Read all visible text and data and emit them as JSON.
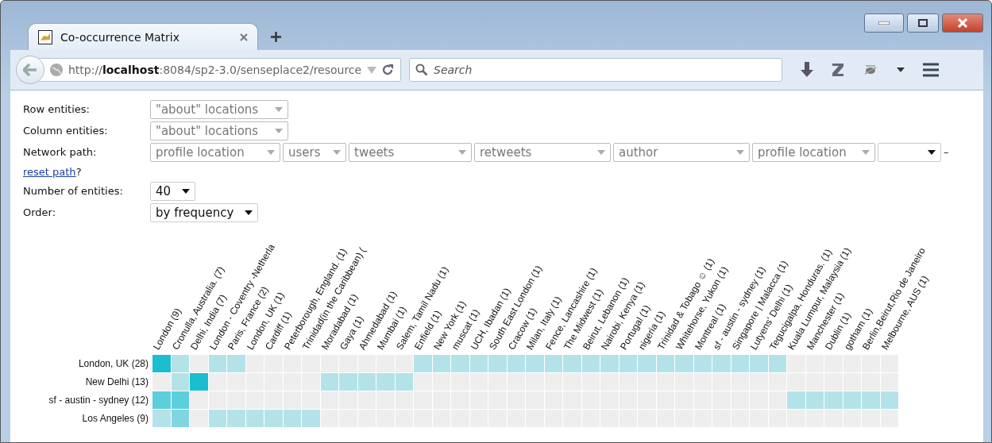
{
  "browser": {
    "tab": {
      "title": "Co-occurrence Matrix",
      "selected": true
    },
    "url_prefix": "http://",
    "url_host": "localhost",
    "url_rest": ":8084/sp2-3.0/senseplace2/resource",
    "search": {
      "placeholder": "Search"
    }
  },
  "form": {
    "fields": [
      {
        "label": "Row entities:",
        "selects": [
          {
            "value": "\"about\" locations",
            "disabled": true
          }
        ]
      },
      {
        "label": "Column entities:",
        "selects": [
          {
            "value": "\"about\" locations",
            "disabled": true
          }
        ]
      },
      {
        "label": "Network path:",
        "selects": [
          {
            "value": "profile location",
            "disabled": true
          },
          {
            "value": "users",
            "disabled": true
          },
          {
            "value": "tweets",
            "disabled": true
          },
          {
            "value": "retweets",
            "disabled": true
          },
          {
            "value": "author",
            "disabled": true
          },
          {
            "value": "profile location",
            "disabled": true
          },
          {
            "disabled": false
          }
        ],
        "suffix": "–"
      }
    ],
    "reset_link": "reset path",
    "reset_suffix": "?",
    "options": [
      {
        "label": "Number of entities:",
        "value": "40"
      },
      {
        "label": "Order:",
        "value": "by frequency"
      }
    ]
  },
  "matrix": {
    "columns": [
      "London (9)",
      "Cronulla, Australia. (7)",
      "Delhi, India (7)",
      "London - Coventry -Netherla",
      "Paris, France (2)",
      "London, UK (1)",
      "Cardiff (1)",
      "Peterborough, England. (1)",
      "Trinidad(in the Caribbean) (",
      "Moradabad (1)",
      "Gaya (1)",
      "Ahmedabad (1)",
      "Mumbai (1)",
      "Salem, Tamil Nadu (1)",
      "Enfield (1)",
      "New York (1)",
      "muscat (1)",
      "UCH, Ibadan (1)",
      "South East London (1)",
      "Cracow (1)",
      "Milan, Italy (1)",
      "Fence, Lancashire (1)",
      "The Midwest (1)",
      "Beirut, Lebanon (1)",
      "Nairobi, Kenya (1)",
      "Portugal (1)",
      "nigeria (1)",
      "Trinidad & Tobago ☺ (1)",
      "Whitehorse, Yukon (1)",
      "Montreal (1)",
      "sf - austin - sydney (1)",
      "Singapore | Malacca (1)",
      "Lutyens' Delhi (1)",
      "Tegucigalpa, Honduras. (1)",
      "Kuala Lumpur, Malaysia (1)",
      "Manchester (1)",
      "Dublin (1)",
      "gotham (1)",
      "Berlin,Beirut,Rio de Janeiro",
      "Melbourne, AUS (1)"
    ],
    "rows": [
      {
        "label": "London, UK (28)",
        "cells": [
          {
            "color": "#1bbdd0"
          },
          {
            "color": "#b3e3e8"
          },
          {
            "color": "#eeeeee"
          },
          {
            "color": "#b3e3e8"
          },
          {
            "color": "#b3e3e8"
          },
          {
            "color": "#eeeeee"
          },
          {
            "color": "#eeeeee"
          },
          {
            "color": "#eeeeee"
          },
          {
            "color": "#eeeeee"
          },
          {
            "color": "#eeeeee"
          },
          {
            "color": "#eeeeee"
          },
          {
            "color": "#eeeeee"
          },
          {
            "color": "#eeeeee"
          },
          {
            "color": "#eeeeee"
          },
          {
            "color": "#b3e3e8"
          },
          {
            "color": "#b3e3e8"
          },
          {
            "color": "#b3e3e8"
          },
          {
            "color": "#b3e3e8"
          },
          {
            "color": "#b3e3e8"
          },
          {
            "color": "#b3e3e8"
          },
          {
            "color": "#b3e3e8"
          },
          {
            "color": "#b3e3e8"
          },
          {
            "color": "#b3e3e8"
          },
          {
            "color": "#b3e3e8"
          },
          {
            "color": "#b3e3e8"
          },
          {
            "color": "#b3e3e8"
          },
          {
            "color": "#b3e3e8"
          },
          {
            "color": "#b3e3e8"
          },
          {
            "color": "#b3e3e8"
          },
          {
            "color": "#b3e3e8"
          },
          {
            "color": "#b3e3e8"
          },
          {
            "color": "#b3e3e8"
          },
          {
            "color": "#b3e3e8"
          },
          {
            "color": "#b3e3e8"
          },
          {
            "color": "#eeeeee"
          },
          {
            "color": "#eeeeee"
          },
          {
            "color": "#eeeeee"
          },
          {
            "color": "#eeeeee"
          },
          {
            "color": "#eeeeee"
          },
          {
            "color": "#eeeeee"
          }
        ]
      },
      {
        "label": "New Delhi (13)",
        "cells": [
          {
            "color": "#eeeeee"
          },
          {
            "color": "#b3e3e8"
          },
          {
            "color": "#1bbdd0"
          },
          {
            "color": "#eeeeee"
          },
          {
            "color": "#eeeeee"
          },
          {
            "color": "#eeeeee"
          },
          {
            "color": "#eeeeee"
          },
          {
            "color": "#eeeeee"
          },
          {
            "color": "#eeeeee"
          },
          {
            "color": "#b3e3e8"
          },
          {
            "color": "#b3e3e8"
          },
          {
            "color": "#b3e3e8"
          },
          {
            "color": "#b3e3e8"
          },
          {
            "color": "#b3e3e8"
          },
          {
            "color": "#eeeeee"
          },
          {
            "color": "#eeeeee"
          },
          {
            "color": "#eeeeee"
          },
          {
            "color": "#eeeeee"
          },
          {
            "color": "#eeeeee"
          },
          {
            "color": "#eeeeee"
          },
          {
            "color": "#eeeeee"
          },
          {
            "color": "#eeeeee"
          },
          {
            "color": "#eeeeee"
          },
          {
            "color": "#eeeeee"
          },
          {
            "color": "#eeeeee"
          },
          {
            "color": "#eeeeee"
          },
          {
            "color": "#eeeeee"
          },
          {
            "color": "#eeeeee"
          },
          {
            "color": "#eeeeee"
          },
          {
            "color": "#eeeeee"
          },
          {
            "color": "#eeeeee"
          },
          {
            "color": "#eeeeee"
          },
          {
            "color": "#eeeeee"
          },
          {
            "color": "#eeeeee"
          },
          {
            "color": "#eeeeee"
          },
          {
            "color": "#eeeeee"
          },
          {
            "color": "#eeeeee"
          },
          {
            "color": "#eeeeee"
          },
          {
            "color": "#eeeeee"
          },
          {
            "color": "#eeeeee"
          }
        ]
      },
      {
        "label": "sf - austin - sydney (12)",
        "cells": [
          {
            "color": "#5ccfdc"
          },
          {
            "color": "#5ccfdc"
          },
          {
            "color": "#eeeeee"
          },
          {
            "color": "#eeeeee"
          },
          {
            "color": "#eeeeee"
          },
          {
            "color": "#eeeeee"
          },
          {
            "color": "#eeeeee"
          },
          {
            "color": "#eeeeee"
          },
          {
            "color": "#eeeeee"
          },
          {
            "color": "#eeeeee"
          },
          {
            "color": "#eeeeee"
          },
          {
            "color": "#eeeeee"
          },
          {
            "color": "#eeeeee"
          },
          {
            "color": "#eeeeee"
          },
          {
            "color": "#eeeeee"
          },
          {
            "color": "#eeeeee"
          },
          {
            "color": "#eeeeee"
          },
          {
            "color": "#eeeeee"
          },
          {
            "color": "#eeeeee"
          },
          {
            "color": "#eeeeee"
          },
          {
            "color": "#eeeeee"
          },
          {
            "color": "#eeeeee"
          },
          {
            "color": "#eeeeee"
          },
          {
            "color": "#eeeeee"
          },
          {
            "color": "#eeeeee"
          },
          {
            "color": "#eeeeee"
          },
          {
            "color": "#eeeeee"
          },
          {
            "color": "#eeeeee"
          },
          {
            "color": "#eeeeee"
          },
          {
            "color": "#eeeeee"
          },
          {
            "color": "#eeeeee"
          },
          {
            "color": "#eeeeee"
          },
          {
            "color": "#eeeeee"
          },
          {
            "color": "#eeeeee"
          },
          {
            "color": "#b3e3e8"
          },
          {
            "color": "#b3e3e8"
          },
          {
            "color": "#b3e3e8"
          },
          {
            "color": "#b3e3e8"
          },
          {
            "color": "#b3e3e8"
          },
          {
            "color": "#b3e3e8"
          }
        ]
      },
      {
        "label": "Los Angeles (9)",
        "cells": [
          {
            "color": "#b3e3e8"
          },
          {
            "color": "#7fd6e0"
          },
          {
            "color": "#eeeeee"
          },
          {
            "color": "#b3e3e8"
          },
          {
            "color": "#b3e3e8"
          },
          {
            "color": "#b3e3e8"
          },
          {
            "color": "#b3e3e8"
          },
          {
            "color": "#b3e3e8"
          },
          {
            "color": "#b3e3e8"
          },
          {
            "color": "#eeeeee"
          },
          {
            "color": "#eeeeee"
          },
          {
            "color": "#eeeeee"
          },
          {
            "color": "#eeeeee"
          },
          {
            "color": "#eeeeee"
          },
          {
            "color": "#eeeeee"
          },
          {
            "color": "#eeeeee"
          },
          {
            "color": "#eeeeee"
          },
          {
            "color": "#eeeeee"
          },
          {
            "color": "#eeeeee"
          },
          {
            "color": "#eeeeee"
          },
          {
            "color": "#eeeeee"
          },
          {
            "color": "#eeeeee"
          },
          {
            "color": "#eeeeee"
          },
          {
            "color": "#eeeeee"
          },
          {
            "color": "#eeeeee"
          },
          {
            "color": "#eeeeee"
          },
          {
            "color": "#eeeeee"
          },
          {
            "color": "#eeeeee"
          },
          {
            "color": "#eeeeee"
          },
          {
            "color": "#eeeeee"
          },
          {
            "color": "#eeeeee"
          },
          {
            "color": "#eeeeee"
          },
          {
            "color": "#eeeeee"
          },
          {
            "color": "#eeeeee"
          },
          {
            "color": "#eeeeee"
          },
          {
            "color": "#eeeeee"
          },
          {
            "color": "#eeeeee"
          },
          {
            "color": "#eeeeee"
          },
          {
            "color": "#eeeeee"
          },
          {
            "color": "#eeeeee"
          }
        ]
      }
    ]
  }
}
